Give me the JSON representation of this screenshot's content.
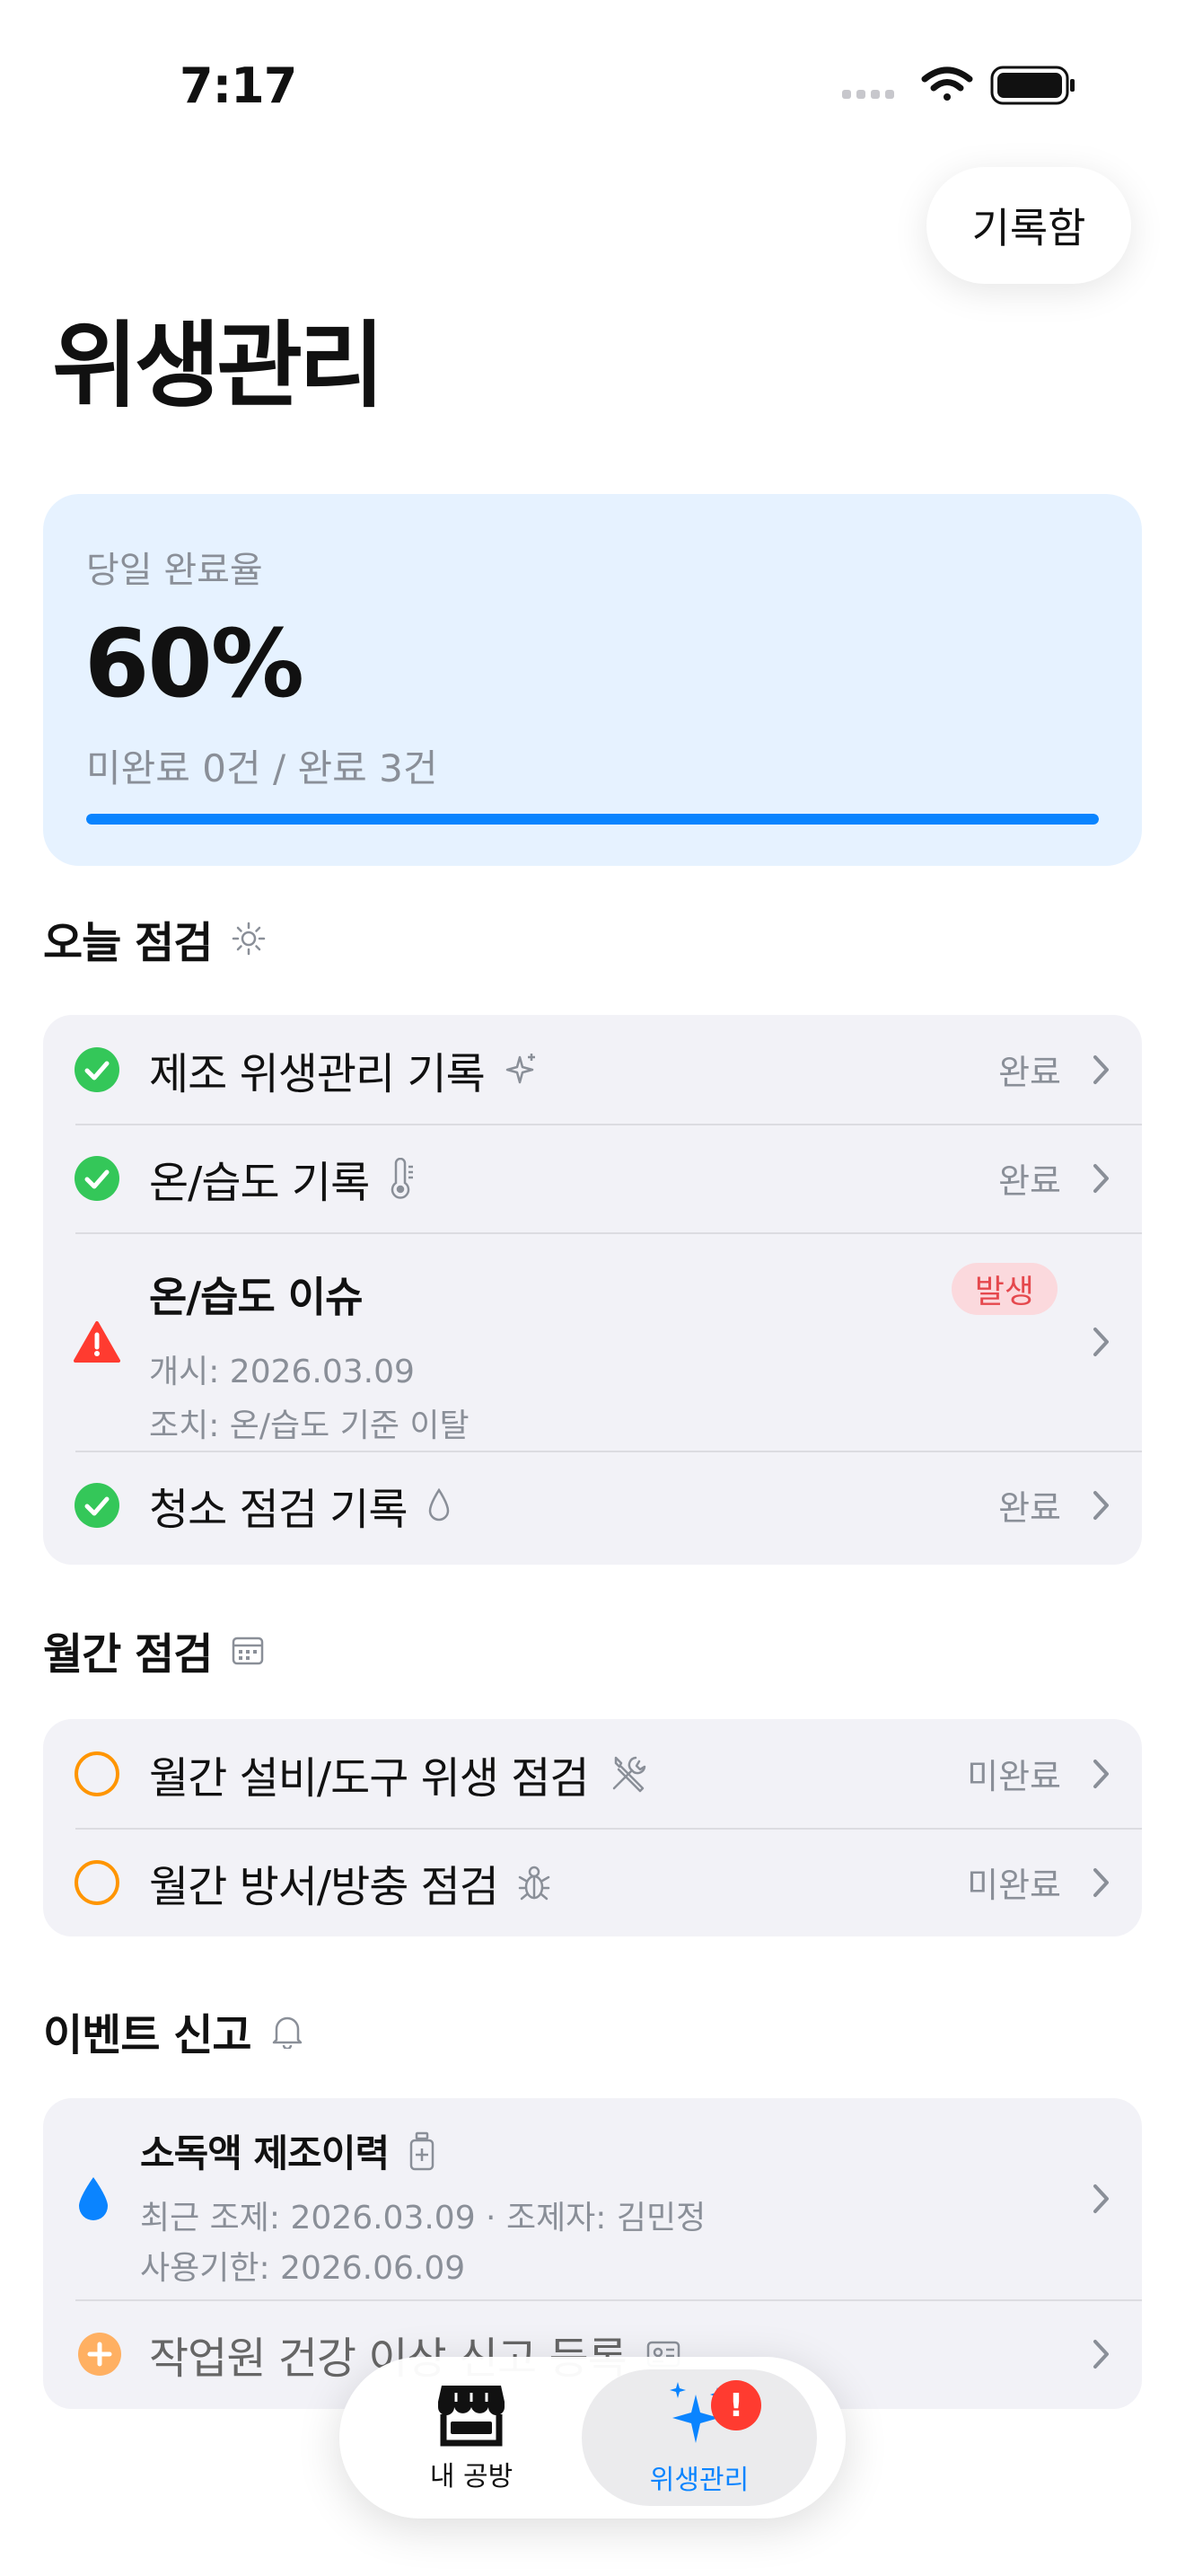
{
  "status_bar": {
    "time": "7:17"
  },
  "header": {
    "records_button": "기록함",
    "title": "위생관리"
  },
  "summary": {
    "label": "당일 완료율",
    "percent": "60%",
    "counts": "미완료 0건 / 완료 3건",
    "progress": 1.0
  },
  "today": {
    "title": "오늘 점검",
    "icon": "sun-icon",
    "items": [
      {
        "title": "제조 위생관리 기록",
        "icon": "sparkle-icon",
        "state": "완료"
      },
      {
        "title": "온/습도 기록",
        "icon": "thermometer-icon",
        "state": "완료"
      },
      {
        "title": "온/습도 이슈",
        "badge": "발생",
        "meta1": "개시: 2026.03.09",
        "meta2": "조치: 온/습도 기준 이탈"
      },
      {
        "title": "청소 점검 기록",
        "icon": "drop-icon",
        "state": "완료"
      }
    ]
  },
  "monthly": {
    "title": "월간 점검",
    "icon": "calendar-icon",
    "items": [
      {
        "title": "월간 설비/도구 위생 점검",
        "icon": "tools-icon",
        "state": "미완료"
      },
      {
        "title": "월간 방서/방충 점검",
        "icon": "bug-icon",
        "state": "미완료"
      }
    ]
  },
  "events": {
    "title": "이벤트 신고",
    "icon": "bell-icon",
    "items": [
      {
        "title": "소독액 제조이력",
        "icon": "bottle-icon",
        "meta1": "최근 조제: 2026.03.09 · 조제자: 김민정",
        "meta2": "사용기한: 2026.06.09"
      },
      {
        "title": "작업원 건강 이상 신고 등록",
        "icon": "id-card-icon"
      }
    ]
  },
  "tabbar": {
    "tabs": [
      {
        "label": "내 공방",
        "icon": "store-icon"
      },
      {
        "label": "위생관리",
        "icon": "sparkles-icon",
        "badge": "!"
      }
    ]
  },
  "colors": {
    "accent": "#0a84ff",
    "success": "#34c759",
    "warning": "#ff9500",
    "danger": "#ff3b30"
  }
}
